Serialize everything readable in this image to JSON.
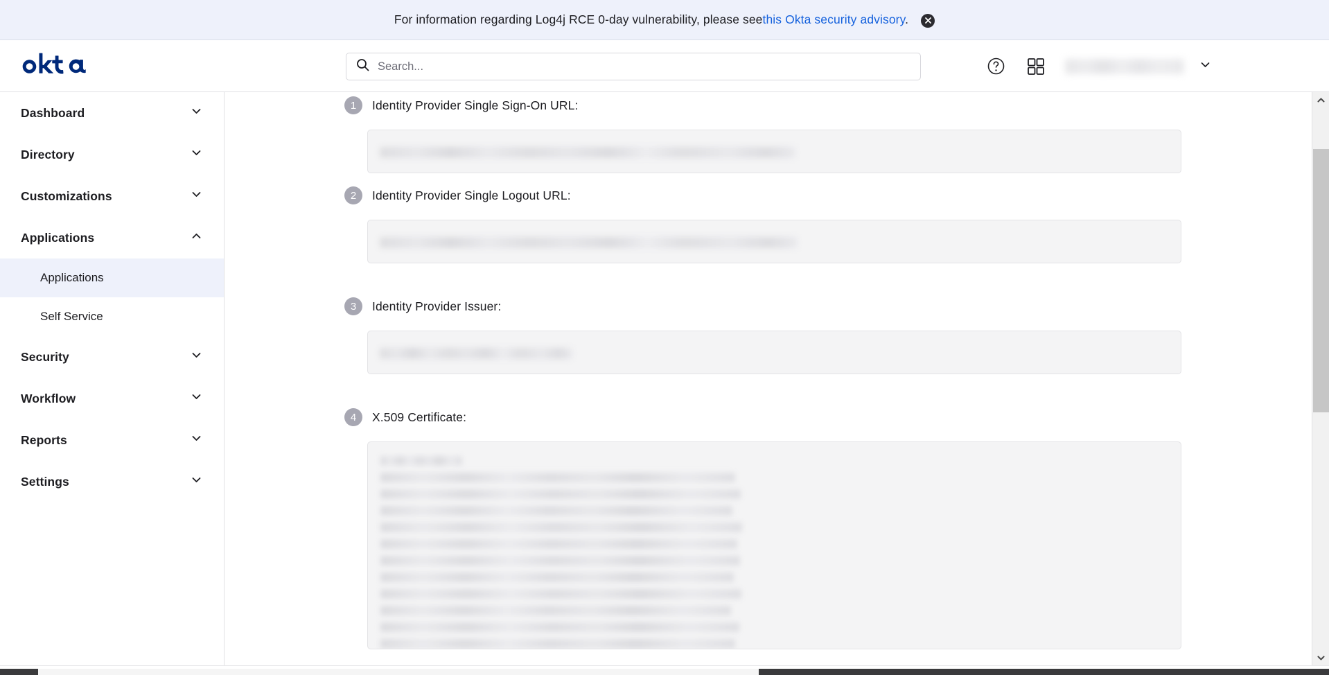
{
  "banner": {
    "text_before": "For information regarding Log4j RCE 0-day vulnerability, please see",
    "link_text": "this Okta security advisory",
    "text_after": ".",
    "close_icon": "close-circle-icon",
    "background_color": "#eef1fb",
    "link_color": "#1662dd"
  },
  "header": {
    "logo_text": "okta",
    "logo_color": "#00297a",
    "search": {
      "placeholder": "Search...",
      "value": "",
      "icon": "search-icon"
    },
    "help_icon": "help-circle-icon",
    "apps_icon": "grid-apps-icon",
    "user_menu": {
      "name": "",
      "chevron_icon": "chevron-down-icon"
    }
  },
  "sidebar": {
    "groups": [
      {
        "label": "Dashboard",
        "expanded": false,
        "chevron": "chevron-down-icon"
      },
      {
        "label": "Directory",
        "expanded": false,
        "chevron": "chevron-down-icon"
      },
      {
        "label": "Customizations",
        "expanded": false,
        "chevron": "chevron-down-icon"
      },
      {
        "label": "Applications",
        "expanded": true,
        "chevron": "chevron-up-icon"
      },
      {
        "label": "Security",
        "expanded": false,
        "chevron": "chevron-down-icon"
      },
      {
        "label": "Workflow",
        "expanded": false,
        "chevron": "chevron-down-icon"
      },
      {
        "label": "Reports",
        "expanded": false,
        "chevron": "chevron-down-icon"
      },
      {
        "label": "Settings",
        "expanded": false,
        "chevron": "chevron-down-icon"
      }
    ],
    "sub_items": [
      {
        "label": "Applications",
        "active": true
      },
      {
        "label": "Self Service",
        "active": false
      }
    ],
    "active_highlight_color": "#eef1fb"
  },
  "main": {
    "fields": [
      {
        "number": "1",
        "label": "Identity Provider Single Sign-On URL:",
        "value": "",
        "redacted": true,
        "type": "text"
      },
      {
        "number": "2",
        "label": "Identity Provider Single Logout URL:",
        "value": "",
        "redacted": true,
        "type": "text"
      },
      {
        "number": "3",
        "label": "Identity Provider Issuer:",
        "value": "",
        "redacted": true,
        "type": "text"
      },
      {
        "number": "4",
        "label": "X.509 Certificate:",
        "value": "",
        "redacted": true,
        "type": "textarea"
      }
    ],
    "badge_color": "#a7a7b2",
    "value_box_background": "#f4f4f5"
  },
  "scrollbars": {
    "vertical": {
      "up_arrow_icon": "chevron-up-icon",
      "down_arrow_icon": "chevron-down-icon"
    },
    "horizontal": {
      "present": true
    }
  }
}
